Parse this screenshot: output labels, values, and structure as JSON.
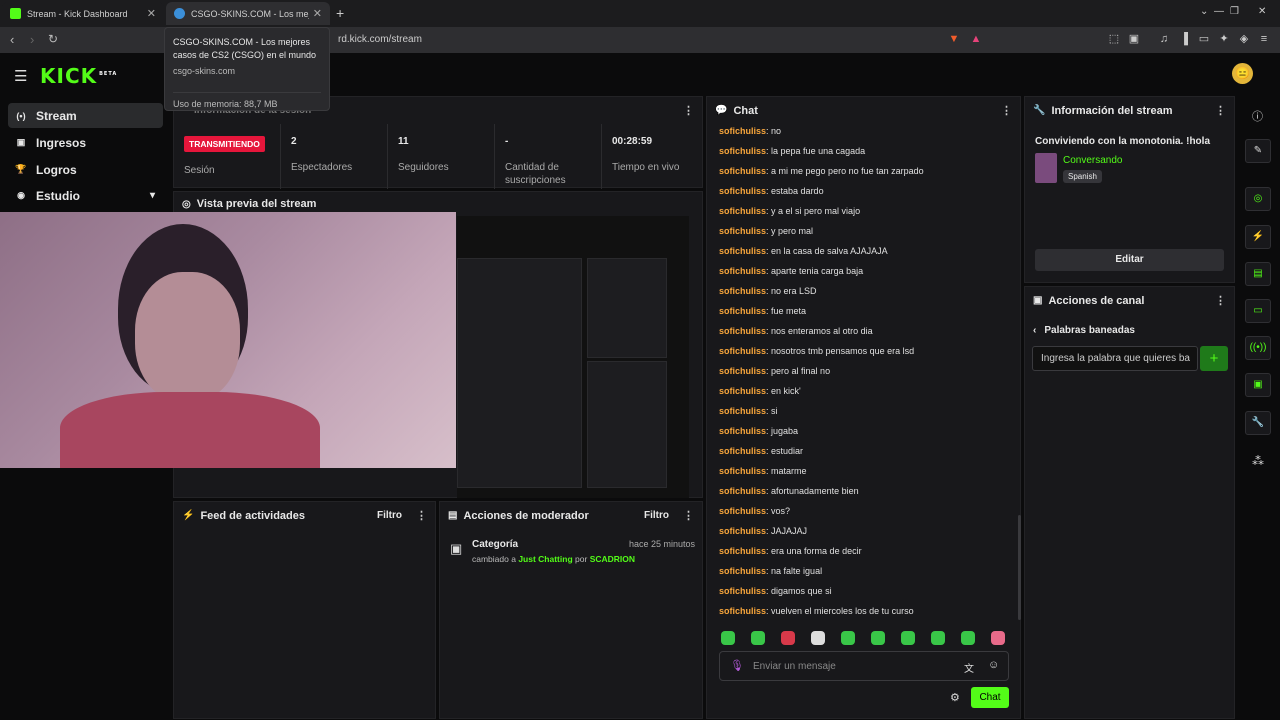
{
  "browser": {
    "tabs": [
      {
        "title": "Stream - Kick Dashboard"
      },
      {
        "title": "CSGO-SKINS.COM - Los mejores"
      }
    ],
    "url": "rd.kick.com/stream",
    "tooltip": {
      "title": "CSGO-SKINS.COM - Los mejores casos de CS2 (CSGO) en el mundo",
      "domain": "csgo-skins.com",
      "memory": "Uso de memoria: 88,7 MB"
    }
  },
  "header": {
    "logo": "KICK",
    "logo_tag": "BETA"
  },
  "sidebar": {
    "items": [
      {
        "label": "Stream",
        "icon": "broadcast-icon"
      },
      {
        "label": "Ingresos",
        "icon": "money-icon"
      },
      {
        "label": "Logros",
        "icon": "trophy-icon"
      },
      {
        "label": "Estudio",
        "icon": "studio-icon"
      }
    ]
  },
  "session": {
    "header_partial": "Información de la sesión",
    "status_badge": "TRANSMITIENDO",
    "stats": [
      {
        "value": "",
        "label": "Sesión"
      },
      {
        "value": "2",
        "label": "Espectadores"
      },
      {
        "value": "11",
        "label": "Seguidores"
      },
      {
        "value": "-",
        "label": "Cantidad de suscripciones"
      },
      {
        "value": "00:28:59",
        "label": "Tiempo en vivo"
      }
    ]
  },
  "preview": {
    "title": "Vista previa del stream"
  },
  "feed": {
    "title": "Feed de actividades",
    "filter": "Filtro"
  },
  "modactions": {
    "title": "Acciones de moderador",
    "filter": "Filtro",
    "entry": {
      "title": "Categoría",
      "time": "hace 25 minutos",
      "prefix": "cambiado a",
      "category": "Just Chatting",
      "by": "por",
      "user": "SCADRION"
    }
  },
  "chat": {
    "title": "Chat",
    "messages": [
      {
        "user": "sofichuliss",
        "text": "no"
      },
      {
        "user": "sofichuliss",
        "text": "la pepa fue una cagada"
      },
      {
        "user": "sofichuliss",
        "text": "a mi me pego pero no fue tan zarpado"
      },
      {
        "user": "sofichuliss",
        "text": "estaba dardo"
      },
      {
        "user": "sofichuliss",
        "text": "y a el si pero mal viajo"
      },
      {
        "user": "sofichuliss",
        "text": "y pero mal"
      },
      {
        "user": "sofichuliss",
        "text": "en la casa de salva AJAJAJA"
      },
      {
        "user": "sofichuliss",
        "text": "aparte tenia carga baja"
      },
      {
        "user": "sofichuliss",
        "text": "no era LSD"
      },
      {
        "user": "sofichuliss",
        "text": "fue meta"
      },
      {
        "user": "sofichuliss",
        "text": "nos enteramos al otro dia"
      },
      {
        "user": "sofichuliss",
        "text": "nosotros tmb pensamos que era lsd"
      },
      {
        "user": "sofichuliss",
        "text": "pero al final no"
      },
      {
        "user": "sofichuliss",
        "text": "en kick'"
      },
      {
        "user": "sofichuliss",
        "text": "si"
      },
      {
        "user": "sofichuliss",
        "text": "jugaba"
      },
      {
        "user": "sofichuliss",
        "text": "estudiar"
      },
      {
        "user": "sofichuliss",
        "text": "matarme"
      },
      {
        "user": "sofichuliss",
        "text": "afortunadamente bien"
      },
      {
        "user": "sofichuliss",
        "text": "vos?"
      },
      {
        "user": "sofichuliss",
        "text": "JAJAJAJ"
      },
      {
        "user": "sofichuliss",
        "text": "era una forma de decir"
      },
      {
        "user": "sofichuliss",
        "text": "na falte igual"
      },
      {
        "user": "sofichuliss",
        "text": "digamos que si"
      },
      {
        "user": "sofichuliss",
        "text": "vuelven el miercoles los de tu curso"
      }
    ],
    "input_placeholder": "Enviar un mensaje",
    "send_label": "Chat"
  },
  "streaminfo": {
    "title": "Información del stream",
    "stream_title": "Conviviendo con la monotonia. !hola",
    "category": "Conversando",
    "language": "Spanish",
    "edit_label": "Editar"
  },
  "channelactions": {
    "title": "Acciones de canal",
    "sub_title": "Palabras baneadas",
    "input_placeholder": "Ingresa la palabra que quieres ba"
  },
  "colors": {
    "accent": "#53fc18",
    "live": "#e6163b",
    "username": "#f7a53b"
  }
}
